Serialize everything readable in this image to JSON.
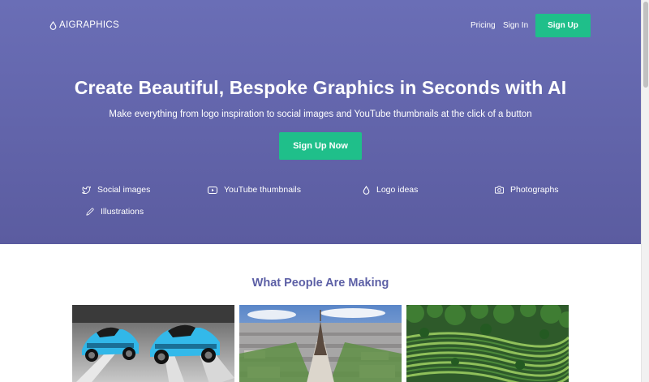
{
  "header": {
    "logo_text": "AIGRAPHICS",
    "nav": {
      "pricing": "Pricing",
      "sign_in": "Sign In",
      "sign_up": "Sign Up"
    }
  },
  "hero": {
    "title": "Create Beautiful, Bespoke Graphics in Seconds with AI",
    "subtitle": "Make everything from logo inspiration to social images and YouTube thumbnails at the click of a button",
    "cta": "Sign Up Now",
    "features": [
      {
        "label": "Social images",
        "icon": "twitter-icon"
      },
      {
        "label": "YouTube thumbnails",
        "icon": "youtube-icon"
      },
      {
        "label": "Logo ideas",
        "icon": "droplet-icon"
      },
      {
        "label": "Photographs",
        "icon": "camera-icon"
      },
      {
        "label": "Illustrations",
        "icon": "pencil-icon"
      }
    ]
  },
  "gallery": {
    "title": "What People Are Making",
    "items": [
      {
        "subject": "blue sports cars"
      },
      {
        "subject": "Paris city view with Eiffel Tower"
      },
      {
        "subject": "rice terraces in jungle"
      }
    ]
  },
  "colors": {
    "hero_top": "#6a6eb6",
    "hero_bottom": "#5b5ca0",
    "accent_green": "#1fbf8a",
    "section_title": "#5d60a6"
  }
}
